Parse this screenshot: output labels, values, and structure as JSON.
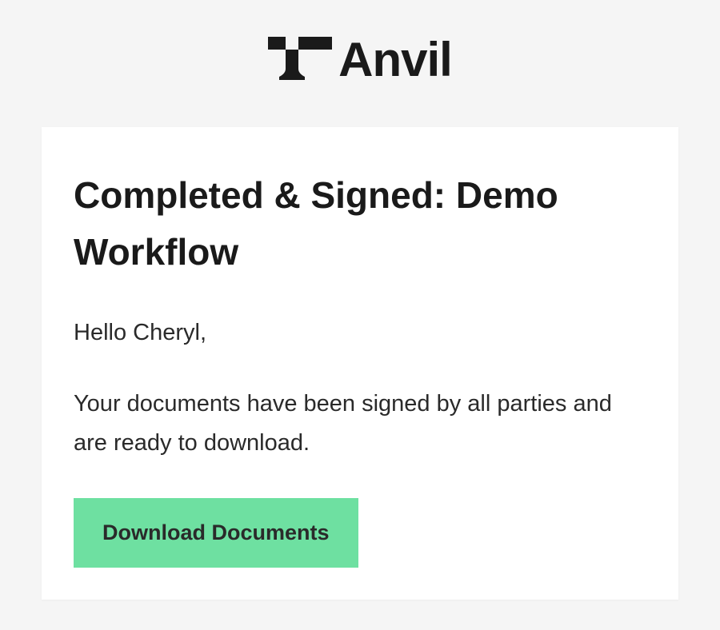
{
  "brand": {
    "name": "Anvil"
  },
  "card": {
    "title": "Completed & Signed: Demo Workflow",
    "greeting": "Hello Cheryl,",
    "body": "Your documents have been signed by all parties and are ready to download.",
    "download_label": "Download Documents"
  }
}
